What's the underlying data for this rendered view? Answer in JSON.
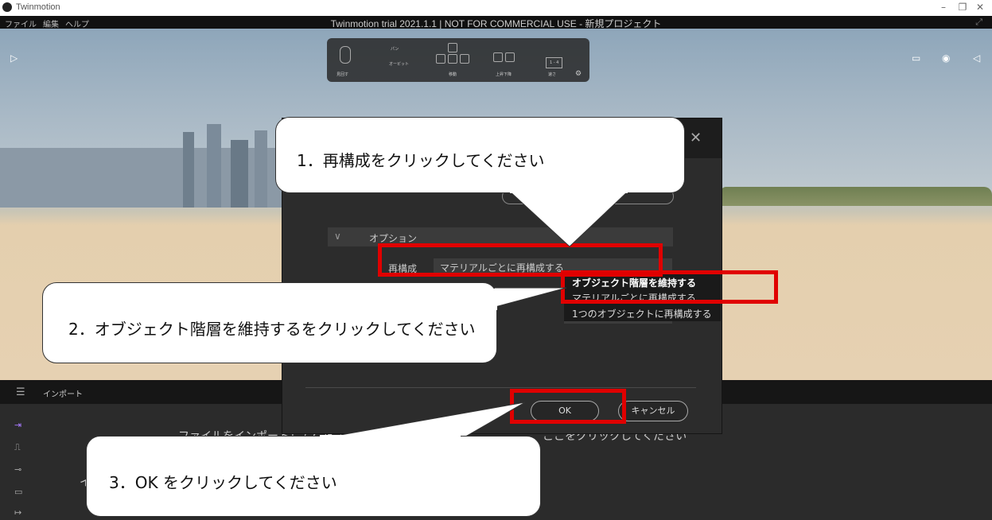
{
  "window": {
    "app_name": "Twinmotion",
    "title": "Twinmotion trial 2021.1.1 | NOT FOR COMMERCIAL USE - 新規プロジェクト",
    "menu": [
      "ファイル",
      "編集",
      "ヘルプ"
    ]
  },
  "nav_help": {
    "pan": "パン",
    "orbit": "オービット",
    "look": "見回す",
    "move": "移動",
    "updown": "上昇下降",
    "speed": "速さ",
    "speed_keys": "1 - 4"
  },
  "import_panel": {
    "title": "インポート",
    "hint_partial": "ファイルをインポートしてください",
    "hint_tail": "ここをクリックしてください",
    "letter": "イ"
  },
  "dialog": {
    "options_label": "オプション",
    "reconstruct_label": "再構成",
    "reconstruct_value": "マテリアルごとに再構成する",
    "ok": "OK",
    "cancel": "キャンセル"
  },
  "dropdown": {
    "options": [
      "オブジェクト階層を維持する",
      "マテリアルごとに再構成する",
      "1つのオブジェクトに再構成する"
    ]
  },
  "callouts": {
    "c1": "1．再構成をクリックしてください",
    "c2": "2．オブジェクト階層を維持するをクリックしてください",
    "c3": "3．OK をクリックしてください"
  },
  "colors": {
    "highlight": "#e00000"
  }
}
